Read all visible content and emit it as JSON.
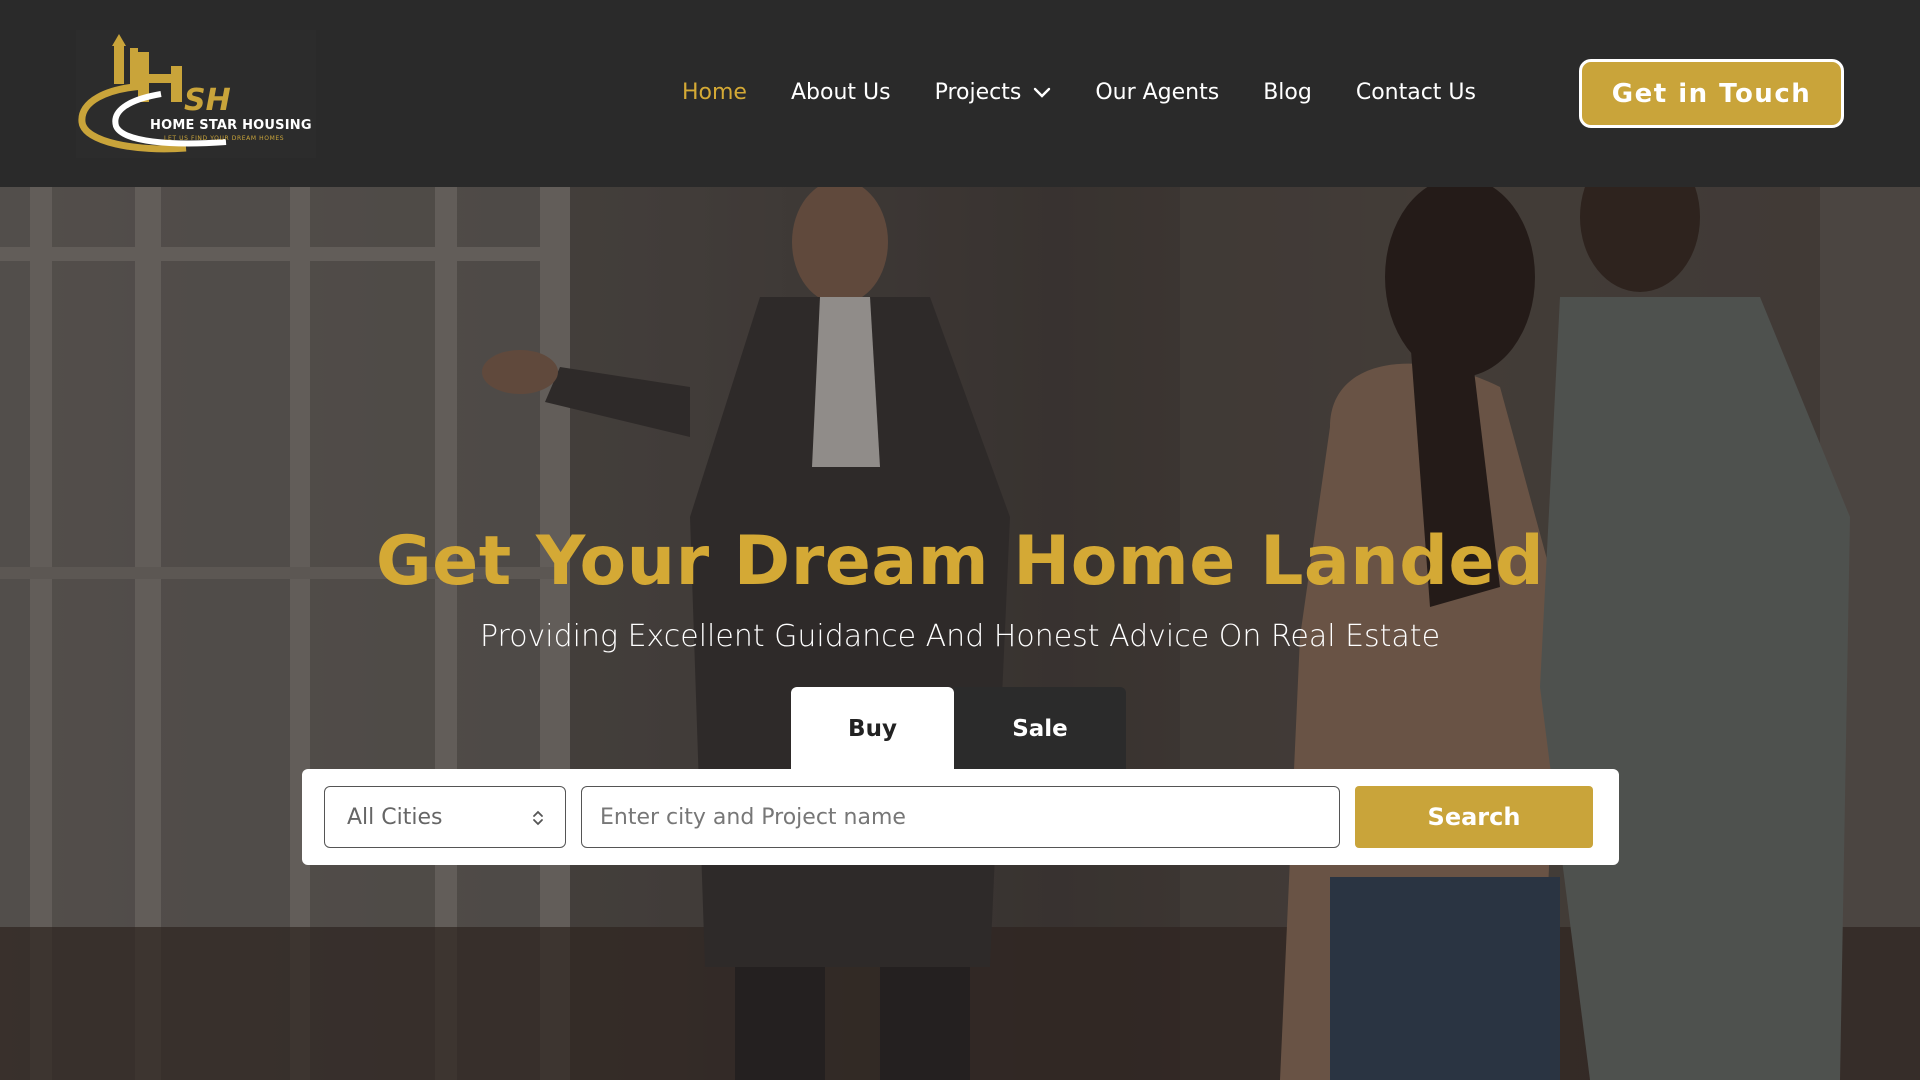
{
  "brand": {
    "name": "HOME STAR HOUSING",
    "tagline": "LET US FIND YOUR DREAM HOMES",
    "monogram": "SH",
    "accent_color": "#c9a43a"
  },
  "nav": {
    "items": [
      {
        "label": "Home",
        "active": true
      },
      {
        "label": "About Us"
      },
      {
        "label": "Projects",
        "has_dropdown": true
      },
      {
        "label": "Our Agents"
      },
      {
        "label": "Blog"
      },
      {
        "label": "Contact Us"
      }
    ],
    "cta_label": "Get in Touch"
  },
  "hero": {
    "title": "Get Your Dream Home Landed",
    "subtitle": "Providing Excellent Guidance And Honest Advice On Real Estate"
  },
  "search": {
    "tabs": [
      {
        "label": "Buy",
        "selected": true
      },
      {
        "label": "Sale",
        "selected": false
      }
    ],
    "city_select": {
      "value": "All Cities"
    },
    "query_input": {
      "placeholder": "Enter city and Project name",
      "value": ""
    },
    "button_label": "Search"
  },
  "icons": {
    "dropdown": "chevron-down-icon",
    "select": "up-down-arrows-icon"
  }
}
